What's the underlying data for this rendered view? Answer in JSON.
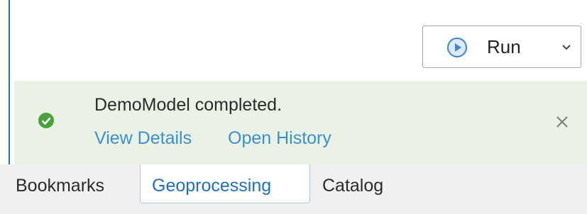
{
  "run": {
    "label": "Run",
    "icon": "play-circle-icon",
    "dropdown_icon": "chevron-down-icon"
  },
  "notification": {
    "message": "DemoModel completed.",
    "links": [
      "View Details",
      "Open History"
    ],
    "status_icon": "success-check-icon",
    "close_icon": "close-icon",
    "background_color": "#e9f2e5",
    "link_color": "#3c8fd1",
    "success_color": "#4aa13b"
  },
  "tabs": [
    {
      "label": "Bookmarks",
      "active": false
    },
    {
      "label": "Geoprocessing",
      "active": true
    },
    {
      "label": "Catalog",
      "active": false
    }
  ],
  "accent_color": "#1f6fc4"
}
